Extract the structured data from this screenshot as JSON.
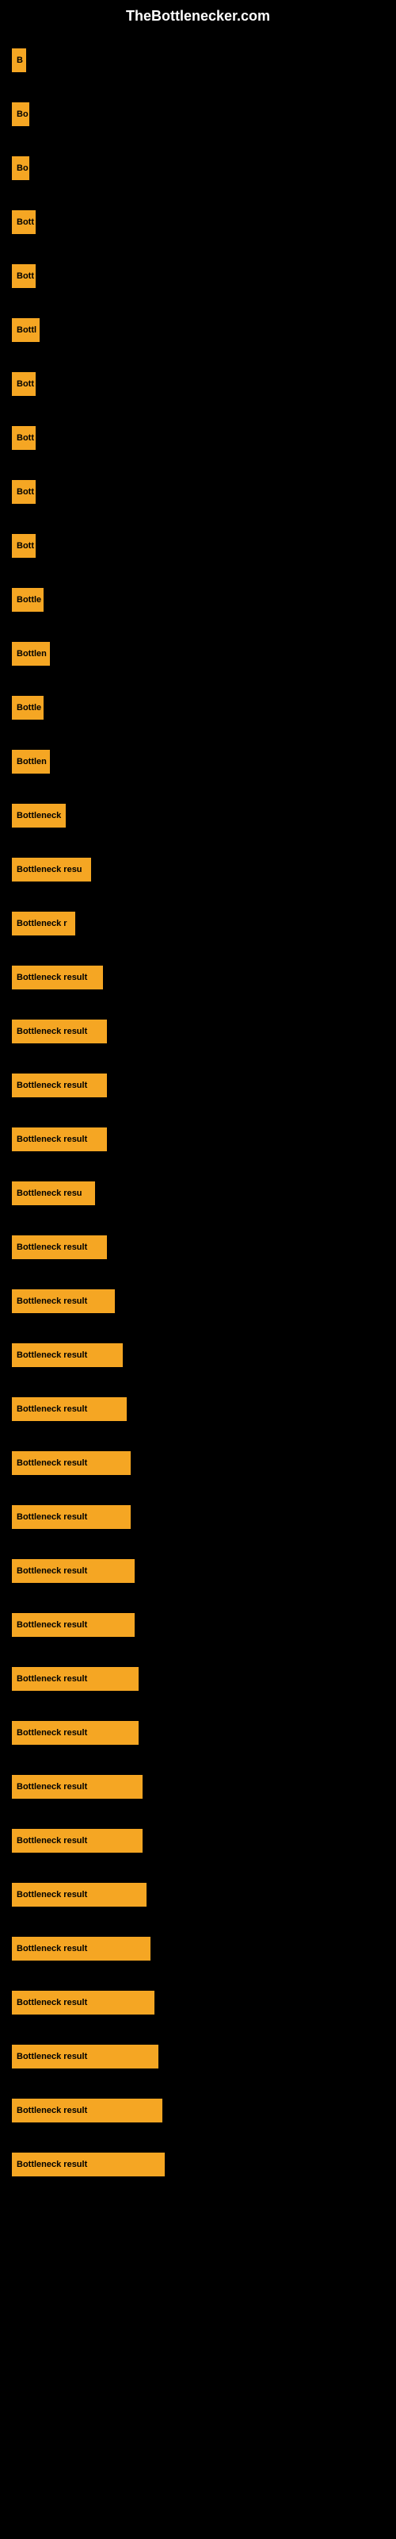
{
  "site": {
    "title": "TheBottlenecker.com"
  },
  "items": [
    {
      "id": 1,
      "label": "B",
      "width": 18
    },
    {
      "id": 2,
      "label": "Bo",
      "width": 22
    },
    {
      "id": 3,
      "label": "Bo",
      "width": 22
    },
    {
      "id": 4,
      "label": "Bott",
      "width": 30
    },
    {
      "id": 5,
      "label": "Bott",
      "width": 30
    },
    {
      "id": 6,
      "label": "Bottl",
      "width": 35
    },
    {
      "id": 7,
      "label": "Bott",
      "width": 30
    },
    {
      "id": 8,
      "label": "Bott",
      "width": 30
    },
    {
      "id": 9,
      "label": "Bott",
      "width": 30
    },
    {
      "id": 10,
      "label": "Bott",
      "width": 30
    },
    {
      "id": 11,
      "label": "Bottle",
      "width": 40
    },
    {
      "id": 12,
      "label": "Bottlen",
      "width": 48
    },
    {
      "id": 13,
      "label": "Bottle",
      "width": 40
    },
    {
      "id": 14,
      "label": "Bottlen",
      "width": 48
    },
    {
      "id": 15,
      "label": "Bottleneck",
      "width": 68
    },
    {
      "id": 16,
      "label": "Bottleneck resu",
      "width": 100
    },
    {
      "id": 17,
      "label": "Bottleneck r",
      "width": 80
    },
    {
      "id": 18,
      "label": "Bottleneck result",
      "width": 115
    },
    {
      "id": 19,
      "label": "Bottleneck result",
      "width": 120
    },
    {
      "id": 20,
      "label": "Bottleneck result",
      "width": 120
    },
    {
      "id": 21,
      "label": "Bottleneck result",
      "width": 120
    },
    {
      "id": 22,
      "label": "Bottleneck resu",
      "width": 105
    },
    {
      "id": 23,
      "label": "Bottleneck result",
      "width": 120
    },
    {
      "id": 24,
      "label": "Bottleneck result",
      "width": 130
    },
    {
      "id": 25,
      "label": "Bottleneck result",
      "width": 140
    },
    {
      "id": 26,
      "label": "Bottleneck result",
      "width": 145
    },
    {
      "id": 27,
      "label": "Bottleneck result",
      "width": 150
    },
    {
      "id": 28,
      "label": "Bottleneck result",
      "width": 150
    },
    {
      "id": 29,
      "label": "Bottleneck result",
      "width": 155
    },
    {
      "id": 30,
      "label": "Bottleneck result",
      "width": 155
    },
    {
      "id": 31,
      "label": "Bottleneck result",
      "width": 160
    },
    {
      "id": 32,
      "label": "Bottleneck result",
      "width": 160
    },
    {
      "id": 33,
      "label": "Bottleneck result",
      "width": 165
    },
    {
      "id": 34,
      "label": "Bottleneck result",
      "width": 165
    },
    {
      "id": 35,
      "label": "Bottleneck result",
      "width": 170
    },
    {
      "id": 36,
      "label": "Bottleneck result",
      "width": 175
    },
    {
      "id": 37,
      "label": "Bottleneck result",
      "width": 180
    },
    {
      "id": 38,
      "label": "Bottleneck result",
      "width": 185
    },
    {
      "id": 39,
      "label": "Bottleneck result",
      "width": 190
    },
    {
      "id": 40,
      "label": "Bottleneck result",
      "width": 193
    }
  ]
}
